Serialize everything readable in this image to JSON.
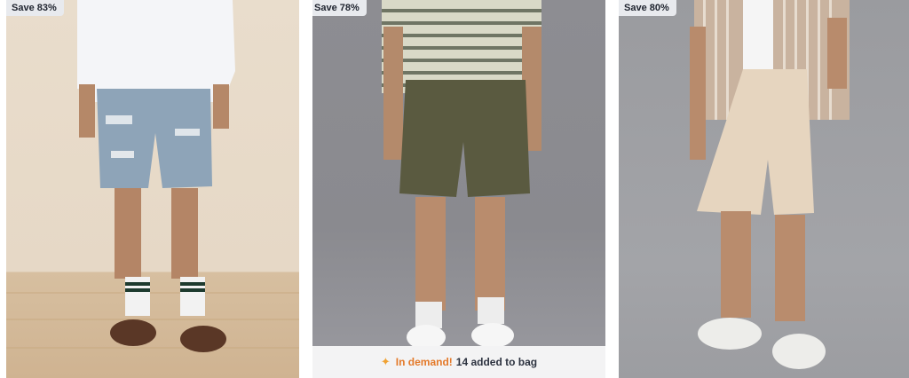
{
  "products": [
    {
      "badge": "Save 83%",
      "image": "model-wearing-light-wash-ripped-denim-shorts"
    },
    {
      "badge": "Save 78%",
      "image": "model-wearing-olive-corduroy-shorts",
      "demand": {
        "label": "In demand!",
        "message": "14 added to bag",
        "icon": "sparkle-icon"
      }
    },
    {
      "badge": "Save 80%",
      "image": "model-wearing-khaki-twill-shorts"
    }
  ],
  "colors": {
    "badge_bg": "#e8eaee",
    "demand_accent": "#e47a2a",
    "demand_bar_bg": "#f3f3f4"
  }
}
